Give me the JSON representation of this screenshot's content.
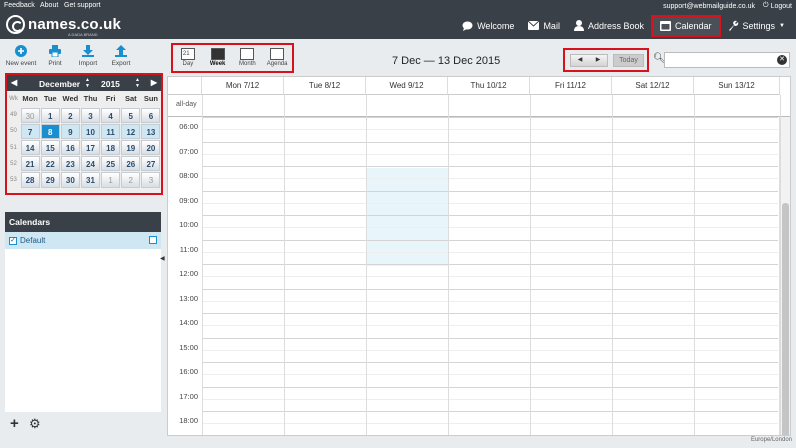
{
  "topbar": {
    "links": [
      "Feedback",
      "About",
      "Get support"
    ],
    "email": "support@webmailguide.co.uk",
    "logout": "Logout"
  },
  "logo": {
    "text": "names.co.uk",
    "sub": "A DADA BRAND"
  },
  "nav": {
    "welcome": "Welcome",
    "mail": "Mail",
    "address_book": "Address Book",
    "calendar": "Calendar",
    "settings": "Settings"
  },
  "toolbar": {
    "new_event": "New event",
    "print": "Print",
    "import": "Import",
    "export": "Export"
  },
  "minical": {
    "month": "December",
    "year": "2015",
    "wk": "Wk",
    "day_headers": [
      "Mon",
      "Tue",
      "Wed",
      "Thu",
      "Fri",
      "Sat",
      "Sun"
    ],
    "weeks": [
      {
        "wk": "49",
        "days": [
          "30",
          "1",
          "2",
          "3",
          "4",
          "5",
          "6"
        ]
      },
      {
        "wk": "50",
        "days": [
          "7",
          "8",
          "9",
          "10",
          "11",
          "12",
          "13"
        ]
      },
      {
        "wk": "51",
        "days": [
          "14",
          "15",
          "16",
          "17",
          "18",
          "19",
          "20"
        ]
      },
      {
        "wk": "52",
        "days": [
          "21",
          "22",
          "23",
          "24",
          "25",
          "26",
          "27"
        ]
      },
      {
        "wk": "53",
        "days": [
          "28",
          "29",
          "30",
          "31",
          "1",
          "2",
          "3"
        ]
      }
    ]
  },
  "calendars": {
    "title": "Calendars",
    "items": [
      {
        "name": "Default"
      }
    ]
  },
  "views": {
    "day": "Day",
    "week": "Week",
    "month": "Month",
    "agenda": "Agenda"
  },
  "range": "7 Dec — 13 Dec 2015",
  "today_label": "Today",
  "search": {
    "value": "",
    "placeholder": ""
  },
  "week": {
    "columns": [
      "Mon 7/12",
      "Tue 8/12",
      "Wed 9/12",
      "Thu 10/12",
      "Fri 11/12",
      "Sat 12/12",
      "Sun 13/12"
    ],
    "allday": "all-day",
    "hours": [
      "06:00",
      "07:00",
      "08:00",
      "09:00",
      "10:00",
      "11:00",
      "12:00",
      "13:00",
      "14:00",
      "15:00",
      "16:00",
      "17:00",
      "18:00"
    ]
  },
  "timezone": "Europe/London",
  "colors": {
    "accent": "#1a8fd0",
    "header": "#3a4047",
    "highlight_red": "#d8121b"
  }
}
